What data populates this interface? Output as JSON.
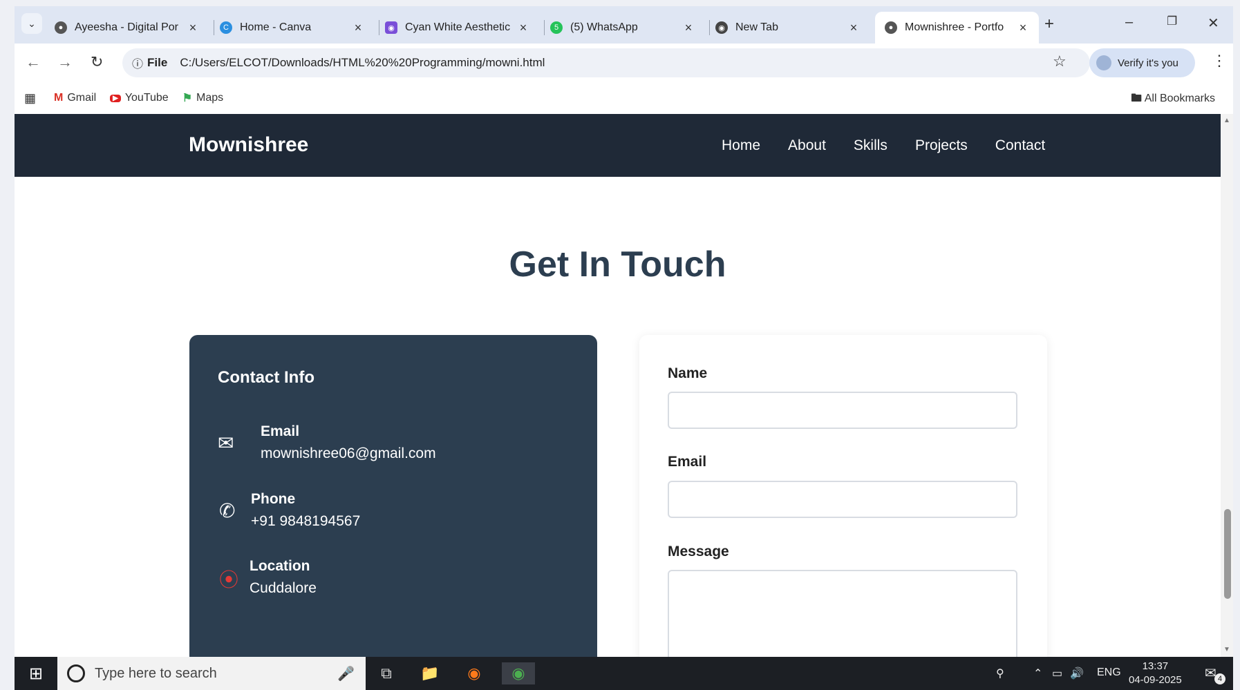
{
  "browser": {
    "tabs": [
      {
        "label": "Ayeesha - Digital Por",
        "favicon": "globe-icon",
        "active": false
      },
      {
        "label": "Home - Canva",
        "favicon": "canva-icon",
        "active": false
      },
      {
        "label": "Cyan White Aesthetic",
        "favicon": "canva-design-icon",
        "active": false
      },
      {
        "label": "(5) WhatsApp",
        "favicon": "whatsapp-icon",
        "active": false
      },
      {
        "label": "New Tab",
        "favicon": "chrome-icon",
        "active": false
      },
      {
        "label": "Mownishree - Portfo",
        "favicon": "globe-icon",
        "active": true
      }
    ],
    "address": {
      "scheme_label": "File",
      "url": "C:/Users/ELCOT/Downloads/HTML%20%20Programming/mowni.html"
    },
    "verify_label": "Verify it's you",
    "bookmarks": [
      {
        "label": "Gmail",
        "icon": "gmail-icon"
      },
      {
        "label": "YouTube",
        "icon": "youtube-icon"
      },
      {
        "label": "Maps",
        "icon": "maps-icon"
      }
    ],
    "all_bookmarks_label": "All Bookmarks"
  },
  "site": {
    "brand": "Mownishree",
    "nav": [
      "Home",
      "About",
      "Skills",
      "Projects",
      "Contact"
    ],
    "section_title": "Get In Touch",
    "contact_info": {
      "title": "Contact Info",
      "items": [
        {
          "label": "Email",
          "value": "mownishree06@gmail.com",
          "icon": "envelope-icon"
        },
        {
          "label": "Phone",
          "value": "+91 9848194567",
          "icon": "phone-icon"
        },
        {
          "label": "Location",
          "value": "Cuddalore",
          "icon": "pin-icon"
        }
      ]
    },
    "form": {
      "name_label": "Name",
      "email_label": "Email",
      "message_label": "Message"
    }
  },
  "taskbar": {
    "search_placeholder": "Type here to search",
    "language": "ENG",
    "time": "13:37",
    "date": "04-09-2025",
    "notification_count": "4"
  }
}
